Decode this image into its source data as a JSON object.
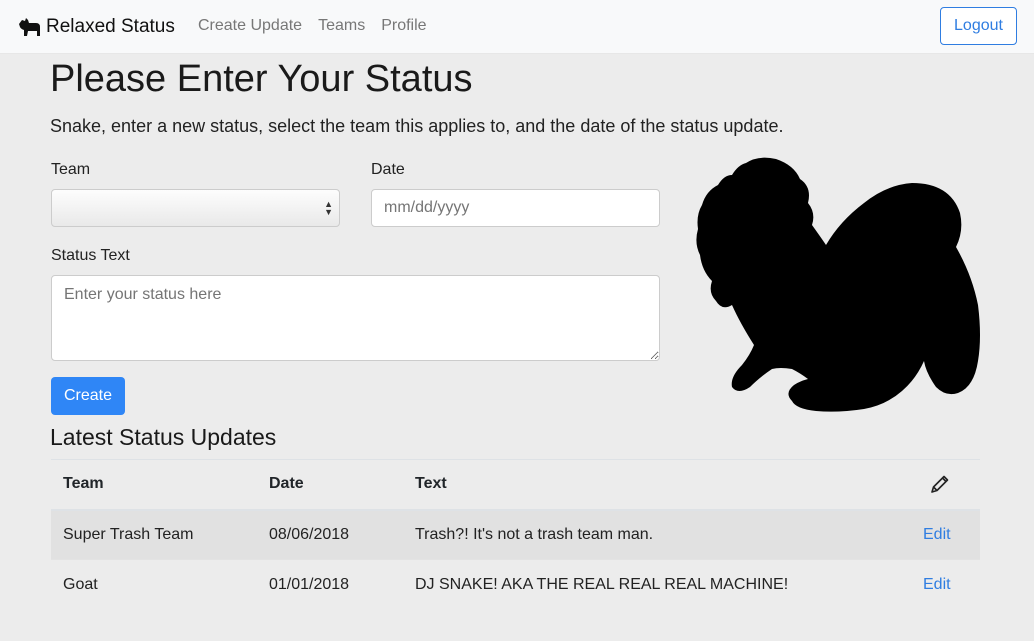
{
  "navbar": {
    "brand": "Relaxed Status",
    "links": [
      "Create Update",
      "Teams",
      "Profile"
    ],
    "logout_label": "Logout"
  },
  "page": {
    "title": "Please Enter Your Status",
    "subtitle": "Snake, enter a new status, select the team this applies to, and the date of the status update."
  },
  "form": {
    "team_label": "Team",
    "team_value": "",
    "date_label": "Date",
    "date_placeholder": "mm/dd/yyyy",
    "status_label": "Status Text",
    "status_placeholder": "Enter your status here",
    "create_label": "Create"
  },
  "updates": {
    "title": "Latest Status Updates",
    "columns": [
      "Team",
      "Date",
      "Text"
    ],
    "header_icon": "pencil-icon",
    "edit_label": "Edit",
    "rows": [
      {
        "team": "Super Trash Team",
        "date": "08/06/2018",
        "text": "Trash?! It's not a trash team man."
      },
      {
        "team": "Goat",
        "date": "01/01/2018",
        "text": "DJ SNAKE! AKA THE REAL REAL REAL MACHINE!"
      }
    ]
  },
  "icons": {
    "brand": "dog-icon",
    "illustration": "dog-silhouette"
  },
  "colors": {
    "accent": "#2f86f6",
    "background": "#ececec",
    "navbar": "#f8f9fa"
  }
}
